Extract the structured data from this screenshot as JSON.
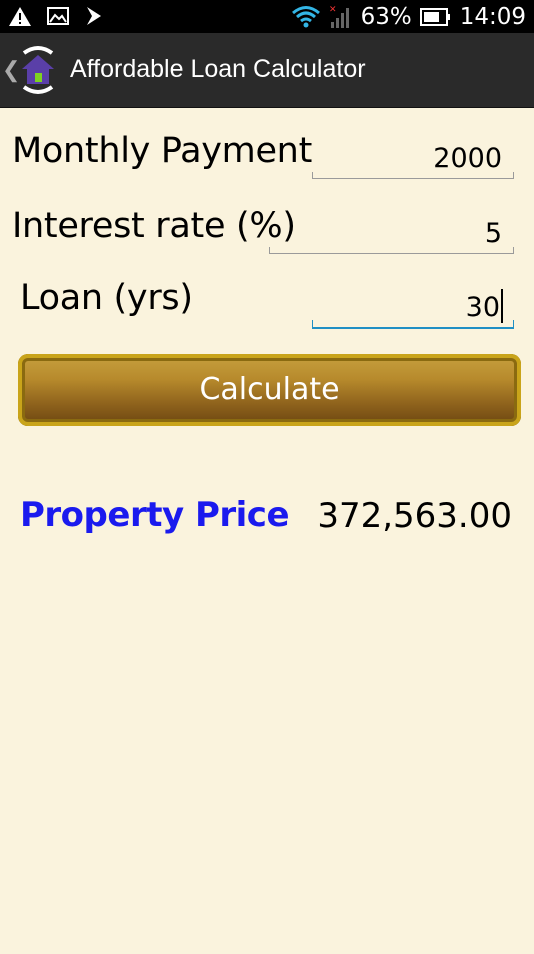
{
  "status_bar": {
    "battery_percent": "63%",
    "time": "14:09",
    "icons": [
      "alert-icon",
      "image-icon",
      "download-icon",
      "wifi-icon",
      "signal-icon",
      "battery-icon"
    ]
  },
  "action_bar": {
    "title": "Affordable Loan Calculator",
    "back_icon": "chevron-left-icon",
    "app_icon": "house-hands-icon"
  },
  "form": {
    "monthly_payment": {
      "label": "Monthly Payment",
      "value": "2000"
    },
    "interest_rate": {
      "label": "Interest rate (%)",
      "value": "5"
    },
    "loan_years": {
      "label": "Loan (yrs)",
      "value": "30"
    }
  },
  "calculate_label": "Calculate",
  "result": {
    "label": "Property Price",
    "value": "372,563.00"
  },
  "colors": {
    "background": "#faf3dd",
    "result_label": "#1a1aee",
    "button_gold": "#b78a2c",
    "active_underline": "#1f8fc4"
  }
}
